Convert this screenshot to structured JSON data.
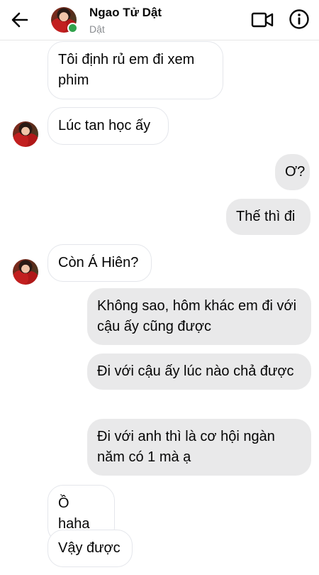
{
  "header": {
    "name": "Ngao Tử Dật",
    "subtitle": "Dật",
    "back_icon": "arrow-left-icon",
    "video_icon": "video-call-icon",
    "info_icon": "info-icon"
  },
  "messages": [
    {
      "sender": "them",
      "text": "Tôi định rủ em đi xem phim"
    },
    {
      "sender": "them",
      "text": "Lúc tan học ấy"
    },
    {
      "sender": "me",
      "text": "Ơ?"
    },
    {
      "sender": "me",
      "text": "Thế thì đi"
    },
    {
      "sender": "them",
      "text": "Còn Á Hiên?"
    },
    {
      "sender": "me",
      "text": "Không sao, hôm khác em đi với cậu ấy cũng được"
    },
    {
      "sender": "me",
      "text": "Đi với cậu ấy lúc nào chả được"
    },
    {
      "sender": "me",
      "text": "Đi với anh thì là cơ hội ngàn năm có 1 mà ạ"
    },
    {
      "sender": "them",
      "text": "Ồ haha"
    },
    {
      "sender": "them",
      "text": "Vậy được"
    }
  ],
  "colors": {
    "incoming_bg": "#ffffff",
    "outgoing_bg": "#e9e9ea",
    "online": "#31a24c"
  }
}
